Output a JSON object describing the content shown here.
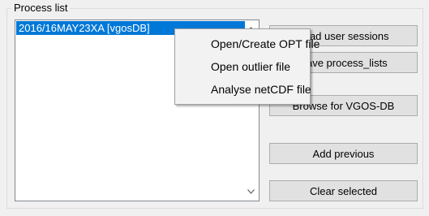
{
  "group": {
    "title": "Process list"
  },
  "listbox": {
    "items": [
      {
        "label": "2016/16MAY23XA [vgosDB]",
        "selected": true
      }
    ]
  },
  "buttons": [
    {
      "label": "Load user sessions",
      "id": "load-user-sessions"
    },
    {
      "label": "Save process_lists",
      "id": "save-process-lists"
    },
    {
      "label": "Browse for VGOS-DB",
      "id": "browse-vgos-db"
    },
    {
      "label": "Add previous",
      "id": "add-previous"
    },
    {
      "label": "Clear selected",
      "id": "clear-selected"
    }
  ],
  "context_menu": {
    "items": [
      {
        "label": "Open/Create OPT file"
      },
      {
        "label": "Open outlier file"
      },
      {
        "label": "Analyse netCDF file"
      }
    ]
  },
  "icons": {
    "scroll_up": "chevron-up-icon",
    "scroll_down": "chevron-down-icon"
  },
  "colors": {
    "selection": "#0078d7",
    "window_bg": "#f0f0f0",
    "button_bg": "#e1e1e1"
  }
}
